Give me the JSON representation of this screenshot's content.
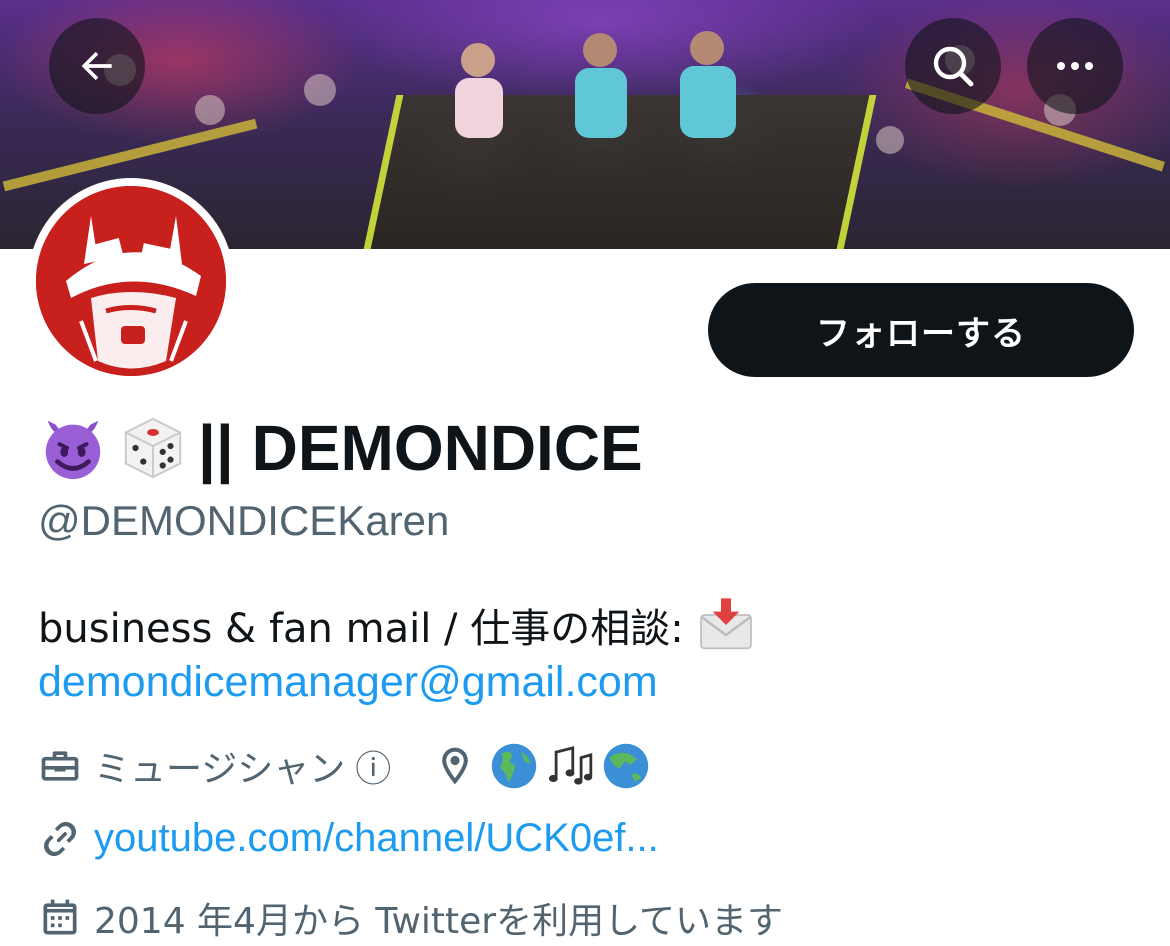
{
  "header": {
    "back_icon": "arrow-left-icon",
    "search_icon": "search-icon",
    "more_icon": "more-horizontal-icon"
  },
  "profile": {
    "display_name": "|| DEMONDICE",
    "name_emojis": [
      "smiling-devil-emoji",
      "dice-emoji"
    ],
    "handle": "@DEMONDICEKaren",
    "follow_label": "フォローする",
    "bio_text": "business & fan mail / 仕事の相談:",
    "bio_emoji": "incoming-envelope-emoji",
    "bio_email": "demondicemanager@gmail.com",
    "category": "ミュージシャン",
    "category_info_glyph": "ⓘ",
    "location_emojis": [
      "globe-americas-emoji",
      "musical-notes-emoji",
      "globe-asia-emoji"
    ],
    "url": "youtube.com/channel/UCK0ef...",
    "joined": "2014 年4月から Twitterを利用しています"
  },
  "colors": {
    "text_primary": "#0f1419",
    "text_secondary": "#536471",
    "link": "#1d9bf0",
    "avatar_red": "#c8201c"
  }
}
